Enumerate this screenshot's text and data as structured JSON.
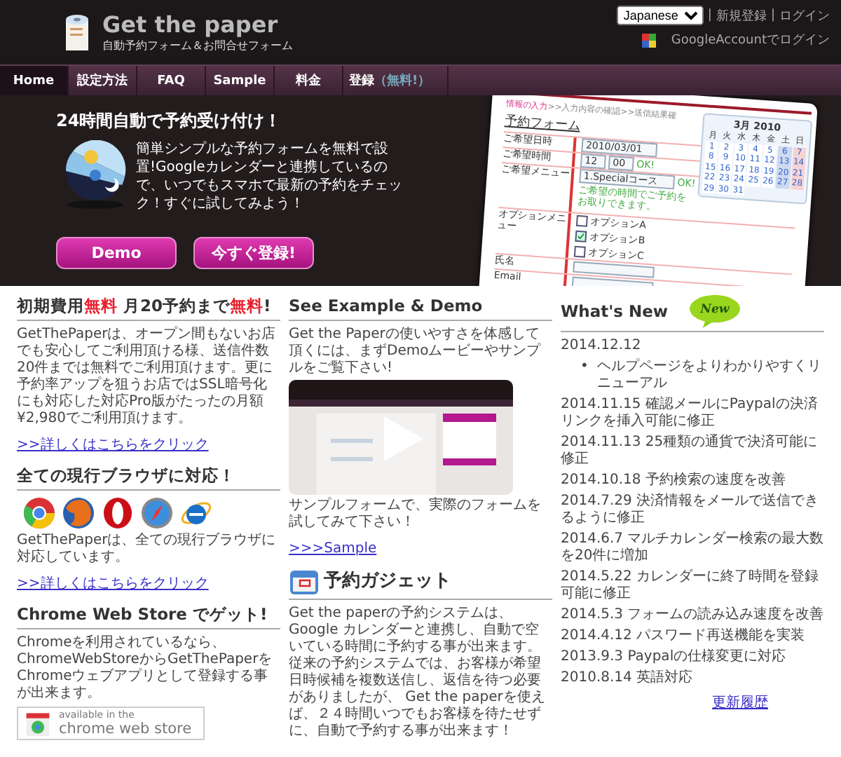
{
  "header": {
    "logo_title": "Get the paper",
    "logo_subtitle": "自動予約フォーム＆お問合せフォーム",
    "language": "Japanese",
    "separator": "|",
    "links": [
      "新規登録",
      "ログイン"
    ],
    "google_login": "GoogleAccountでログイン"
  },
  "nav": [
    {
      "label": "Home",
      "selected": true
    },
    {
      "label": "設定方法",
      "selected": false
    },
    {
      "label": "FAQ",
      "selected": false
    },
    {
      "label": "Sample",
      "selected": false
    },
    {
      "label": "料金",
      "selected": false
    },
    {
      "label": "登録",
      "note": "（無料!）",
      "selected": false
    }
  ],
  "hero": {
    "heading": "24時間自動で予約受け付け！",
    "text": "簡単シンプルな予約フォームを無料で設置!Googleカレンダーと連携しているので、いつでもスマホで最新の予約をチェック！すぐに試してみよう！",
    "buttons": [
      "Demo",
      "今すぐ登録!"
    ]
  },
  "form_preview": {
    "steps": "情報の入力",
    "steps_rest": ">>入力内容の確認>>送信結果確",
    "title": "予約フォーム",
    "fields": [
      {
        "label": "ご希望日時",
        "kind": "date",
        "value": "2010/03/01"
      },
      {
        "label": "ご希望時間",
        "kind": "time",
        "values": [
          "12",
          "00"
        ],
        "ok": "OK!"
      },
      {
        "label": "ご希望メニュー",
        "kind": "select",
        "value": "1.Specialコース",
        "ok": "OK!",
        "note": "ご希望の時間でご予約をお取りできます。"
      },
      {
        "label": "オプションメニュー",
        "kind": "checks",
        "options": [
          {
            "label": "オプションA",
            "checked": false
          },
          {
            "label": "オプションB",
            "checked": true
          },
          {
            "label": "オプションC",
            "checked": false
          }
        ]
      },
      {
        "label": "氏名",
        "kind": "text"
      },
      {
        "label": "Email",
        "kind": "text"
      }
    ],
    "calendar": {
      "month": "3月 2010",
      "weekdays": [
        "月",
        "火",
        "水",
        "木",
        "金",
        "土",
        "日"
      ],
      "days": [
        "1",
        "2",
        "3",
        "4",
        "5",
        "6",
        "7",
        "8",
        "9",
        "10",
        "11",
        "12",
        "13",
        "14",
        "15",
        "16",
        "17",
        "18",
        "19",
        "20",
        "21",
        "22",
        "23",
        "24",
        "25",
        "26",
        "27",
        "28",
        "29",
        "30",
        "31"
      ]
    }
  },
  "columns": [
    {
      "sections": [
        {
          "kind": "text",
          "heading": [
            {
              "text": "初期費用",
              "highlight": false
            },
            {
              "text": "無料",
              "highlight": true
            },
            {
              "text": " 月20予約まで",
              "highlight": false
            },
            {
              "text": "無料",
              "highlight": true
            },
            {
              "text": "!",
              "highlight": false
            }
          ],
          "text": "GetThePaperは、オープン間もないお店でも安心してご利用頂ける様、送信件数20件までは無料でご利用頂けます。更に予約率アップを狙うお店ではSSL暗号化にも対応した対応Pro版がたったの月額¥2,980でご利用頂けます。",
          "link": ">>詳しくはこちらをクリック"
        },
        {
          "kind": "browsers",
          "heading": "全ての現行ブラウザに対応！",
          "text": "GetThePaperは、全ての現行ブラウザに対応しています。",
          "link": ">>詳しくはこちらをクリック"
        },
        {
          "kind": "store",
          "heading": "Chrome Web Store でゲット!",
          "text": "Chromeを利用されているなら、ChromeWebStoreからGetThePaperをChromeウェブアプリとして登録する事が出来ます。",
          "badge": [
            "available in the",
            "chrome web store"
          ]
        }
      ]
    },
    {
      "sections": [
        {
          "kind": "video",
          "heading": "See Example & Demo",
          "text": "Get the Paperの使いやすさを体感して頂くには、まずDemoムービーやサンプルをご覧下さい!",
          "after": "サンプルフォームで、実際のフォームを試してみて下さい！",
          "link": ">>>Sample"
        },
        {
          "kind": "gadget",
          "heading": "予約ガジェット",
          "text": "Get the paperの予約システムは、Google カレンダーと連携し、自動で空いている時間に予約する事が出来ます。従来の予約システムでは、お客様が希望日時候補を複数送信し、返信を待つ必要がありましたが、 Get the paperを使えば、２４時間いつでもお客様を待たせずに、自動で予約する事が出来ます！"
        }
      ]
    }
  ],
  "news": {
    "heading": "What's New",
    "badge": "New",
    "items": [
      {
        "date": "2014.12.12",
        "bullets": [
          {
            "marker": "•",
            "text": "ヘルプページをよりわかりやすくリニューアル"
          }
        ]
      },
      {
        "text": "2014.11.15 確認メールにPaypalの決済リンクを挿入可能に修正"
      },
      {
        "text": "2014.11.13 25種類の通貨で決済可能に修正"
      },
      {
        "text": "2014.10.18 予約検索の速度を改善"
      },
      {
        "text": "2014.7.29 決済情報をメールで送信できるように修正"
      },
      {
        "text": "2014.6.7 マルチカレンダー検索の最大数を20件に増加"
      },
      {
        "text": "2014.5.22 カレンダーに終了時間を登録可能に修正"
      },
      {
        "text": "2014.5.3 フォームの読み込み速度を改善"
      },
      {
        "text": "2014.4.12 パスワード再送機能を実装"
      },
      {
        "text": "2013.9.3 Paypalの仕様変更に対応"
      },
      {
        "text": "2010.8.14 英語対応"
      }
    ],
    "link": "更新履歴"
  }
}
